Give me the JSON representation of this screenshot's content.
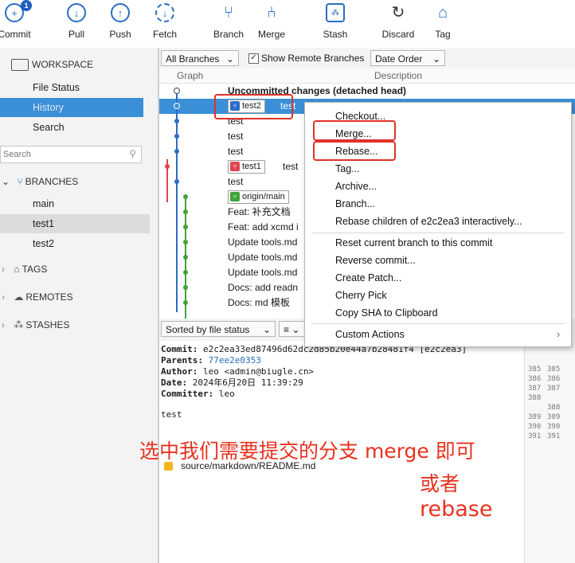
{
  "toolbar": {
    "commit": "Commit",
    "commit_badge": "1",
    "pull": "Pull",
    "push": "Push",
    "fetch": "Fetch",
    "branch": "Branch",
    "merge": "Merge",
    "stash": "Stash",
    "discard": "Discard",
    "tag": "Tag"
  },
  "sidebar": {
    "workspace": "WORKSPACE",
    "file_status": "File Status",
    "history": "History",
    "search_item": "Search",
    "search_placeholder": "Search",
    "branches": "BRANCHES",
    "branch_items": [
      "main",
      "test1",
      "test2"
    ],
    "tags": "TAGS",
    "remotes": "REMOTES",
    "stashes": "STASHES"
  },
  "filter": {
    "all_branches": "All Branches",
    "show_remote": "Show Remote Branches",
    "date_order": "Date Order"
  },
  "columns": {
    "graph": "Graph",
    "description": "Description"
  },
  "commits": [
    "Uncommitted changes (detached head)",
    "test",
    "test",
    "test",
    "test",
    "test",
    "test",
    "Feat: 补充文档",
    "Feat: add xcmd i",
    "Update tools.md",
    "Update tools.md",
    "Update tools.md",
    "Docs: add readn",
    "Docs: md 模板"
  ],
  "branch_tags": {
    "test2": "test2",
    "test1": "test1",
    "origin_main": "origin/main"
  },
  "context_menu": {
    "checkout": "Checkout...",
    "merge": "Merge...",
    "rebase": "Rebase...",
    "tag": "Tag...",
    "archive": "Archive...",
    "branch": "Branch...",
    "rebase_children": "Rebase children of e2c2ea3 interactively...",
    "reset": "Reset current branch to this commit",
    "reverse": "Reverse commit...",
    "patch": "Create Patch...",
    "cherry": "Cherry Pick",
    "copy_sha": "Copy SHA to Clipboard",
    "custom": "Custom Actions"
  },
  "bottom_bar": {
    "sorted": "Sorted by file status"
  },
  "detail": {
    "commit_label": "Commit:",
    "commit_value": "e2c2ea33ed87496d62dc2d85b20e44a7b28481f4 [e2c2ea3]",
    "parents_label": "Parents:",
    "parents_value": "77ee2e0353",
    "author_label": "Author:",
    "author_value": "leo <admin@biugle.cn>",
    "date_label": "Date:",
    "date_value": "2024年6月20日 11:39:29",
    "committer_label": "Committer:",
    "committer_value": "leo",
    "message": "test",
    "file": "source/markdown/README.md"
  },
  "line_numbers": [
    [
      "385",
      "385"
    ],
    [
      "386",
      "386"
    ],
    [
      "387",
      "387"
    ],
    [
      "388",
      ""
    ],
    [
      "",
      "388"
    ],
    [
      "389",
      "389"
    ],
    [
      "390",
      "390"
    ],
    [
      "391",
      "391"
    ]
  ],
  "annotation": {
    "line1": "选中我们需要提交的分支 merge 即可",
    "line2": "或者",
    "line3": "rebase"
  },
  "colors": {
    "accent": "#3b8fd6",
    "annotation": "#e8321f",
    "graph_blue": "#2b6cc4",
    "graph_red": "#e0434f",
    "graph_green": "#3fa33a"
  }
}
